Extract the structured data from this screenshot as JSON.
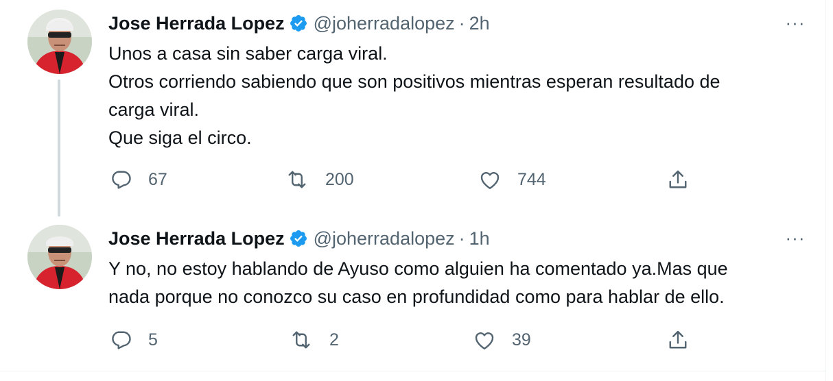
{
  "tweets": [
    {
      "author": {
        "name": "Jose Herrada Lopez",
        "handle": "@joherradalopez",
        "verified": true,
        "verified_icon": "verified-badge-icon"
      },
      "separator": "·",
      "time": "2h",
      "more": "···",
      "text_lines": [
        "Unos a casa sin saber carga viral.",
        "Otros corriendo sabiendo que son positivos mientras esperan resultado de",
        "carga viral.",
        "Que siga el circo."
      ],
      "actions": {
        "replies": "67",
        "retweets": "200",
        "likes": "744"
      }
    },
    {
      "author": {
        "name": "Jose Herrada Lopez",
        "handle": "@joherradalopez",
        "verified": true,
        "verified_icon": "verified-badge-icon"
      },
      "separator": "·",
      "time": "1h",
      "more": "···",
      "text_lines": [
        "Y no, no estoy hablando de Ayuso como alguien ha comentado ya.Mas que",
        "nada porque no conozco su caso en profundidad como para hablar de ello."
      ],
      "actions": {
        "replies": "5",
        "retweets": "2",
        "likes": "39"
      }
    }
  ],
  "colors": {
    "text": "#0f1419",
    "secondary": "#536471",
    "verified": "#1d9bf0",
    "thread_line": "#cfd9de",
    "divider": "#eff3f4"
  }
}
